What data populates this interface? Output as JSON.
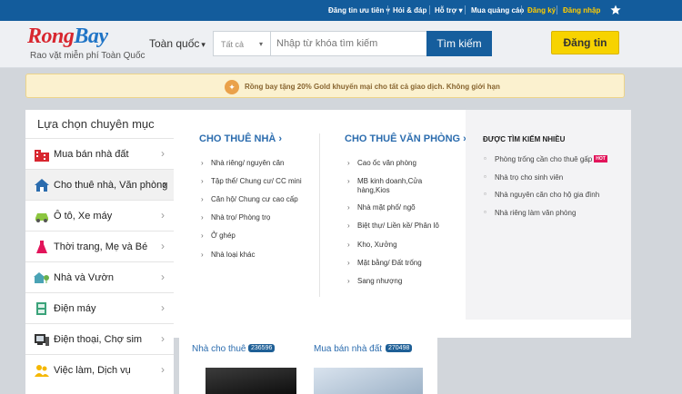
{
  "topbar": {
    "items": [
      "Đăng tin ưu tiên",
      "Hỏi & đáp",
      "Hỗ trợ",
      "Mua quảng cáo",
      "Đăng ký",
      "Đăng nhập"
    ],
    "star_icon": "star-icon"
  },
  "header": {
    "logo_left": "Rong",
    "logo_right": "Bay",
    "slogan": "Rao vặt miễn phí Toàn Quốc",
    "location": "Toàn quốc",
    "category_select": "Tất cả",
    "search_placeholder": "Nhập từ khóa tìm kiếm",
    "search_button": "Tìm kiếm",
    "post_button": "Đăng tin"
  },
  "promo": {
    "text": "Rồng bay tặng 20% Gold khuyến mại cho tất cả giao dịch. Không giới hạn"
  },
  "sidebar": {
    "title": "Lựa chọn chuyên mục",
    "items": [
      {
        "label": "Mua bán nhà đất",
        "icon": "building-icon"
      },
      {
        "label": "Cho thuê nhà, Văn phòng",
        "icon": "house-icon"
      },
      {
        "label": "Ô tô, Xe máy",
        "icon": "car-icon"
      },
      {
        "label": "Thời trang, Mẹ và Bé",
        "icon": "dress-icon"
      },
      {
        "label": "Nhà và Vườn",
        "icon": "garden-house-icon"
      },
      {
        "label": "Điện máy",
        "icon": "appliance-icon"
      },
      {
        "label": "Điện thoại, Chợ sim",
        "icon": "phone-icon"
      },
      {
        "label": "Việc làm, Dịch vụ",
        "icon": "people-icon"
      }
    ]
  },
  "mega": {
    "col1_title": "CHO THUÊ NHÀ",
    "col1_items": [
      "Nhà riêng/ nguyên căn",
      "Tập thể/ Chung cư/ CC mini",
      "Căn hộ/ Chung cư cao cấp",
      "Nhà trọ/ Phòng trọ",
      "Ở ghép",
      "Nhà loại khác"
    ],
    "col2_title": "CHO THUÊ VĂN PHÒNG",
    "col2_items": [
      "Cao ốc văn phòng",
      "MB kinh doanh,Cửa hàng,Kios",
      "Nhà mặt phố/ ngõ",
      "Biệt thự/ Liền kề/ Phân lô",
      "Kho, Xưởng",
      "Mặt bằng/ Đất trống",
      "Sang nhượng"
    ],
    "popular_title": "ĐƯỢC TÌM KIẾM NHIỀU",
    "popular_items": [
      "Phòng trống cần cho thuê gấp",
      "Nhà trọ cho sinh viên",
      "Nhà nguyên căn cho hộ gia đình",
      "Nhà riêng làm văn phòng"
    ],
    "hot_badge": "HOT"
  },
  "lower": {
    "sec1_title": "Nhà cho thuê",
    "sec1_count": "236596",
    "sec2_title": "Mua bán nhà đất",
    "sec2_count": "270498"
  }
}
